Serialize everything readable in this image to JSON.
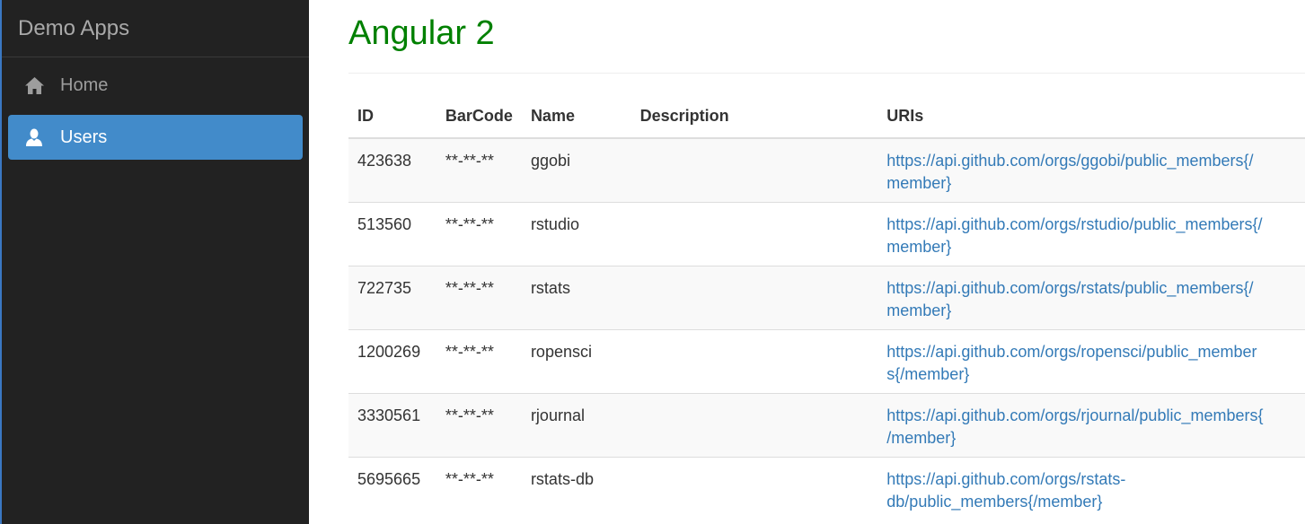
{
  "sidebar": {
    "brand": "Demo Apps",
    "items": [
      {
        "label": "Home",
        "icon": "home-icon",
        "active": false
      },
      {
        "label": "Users",
        "icon": "user-icon",
        "active": true
      }
    ]
  },
  "main": {
    "title": "Angular 2",
    "table": {
      "headers": {
        "id": "ID",
        "barcode": "BarCode",
        "name": "Name",
        "description": "Description",
        "uris": "URIs"
      },
      "rows": [
        {
          "id": "423638",
          "barcode": "**-**-**",
          "name": "ggobi",
          "description": "",
          "uri": "https://api.github.com/orgs/ggobi/public_members{/member}"
        },
        {
          "id": "513560",
          "barcode": "**-**-**",
          "name": "rstudio",
          "description": "",
          "uri": "https://api.github.com/orgs/rstudio/public_members{/member}"
        },
        {
          "id": "722735",
          "barcode": "**-**-**",
          "name": "rstats",
          "description": "",
          "uri": "https://api.github.com/orgs/rstats/public_members{/member}"
        },
        {
          "id": "1200269",
          "barcode": "**-**-**",
          "name": "ropensci",
          "description": "",
          "uri": "https://api.github.com/orgs/ropensci/public_members{/member}"
        },
        {
          "id": "3330561",
          "barcode": "**-**-**",
          "name": "rjournal",
          "description": "",
          "uri": "https://api.github.com/orgs/rjournal/public_members{/member}"
        },
        {
          "id": "5695665",
          "barcode": "**-**-**",
          "name": "rstats-db",
          "description": "",
          "uri": "https://api.github.com/orgs/rstats-db/public_members{/member}"
        }
      ]
    }
  },
  "colors": {
    "sidebar_bg": "#222222",
    "active_item": "#428bca",
    "title": "#008000",
    "link": "#337ab7"
  }
}
